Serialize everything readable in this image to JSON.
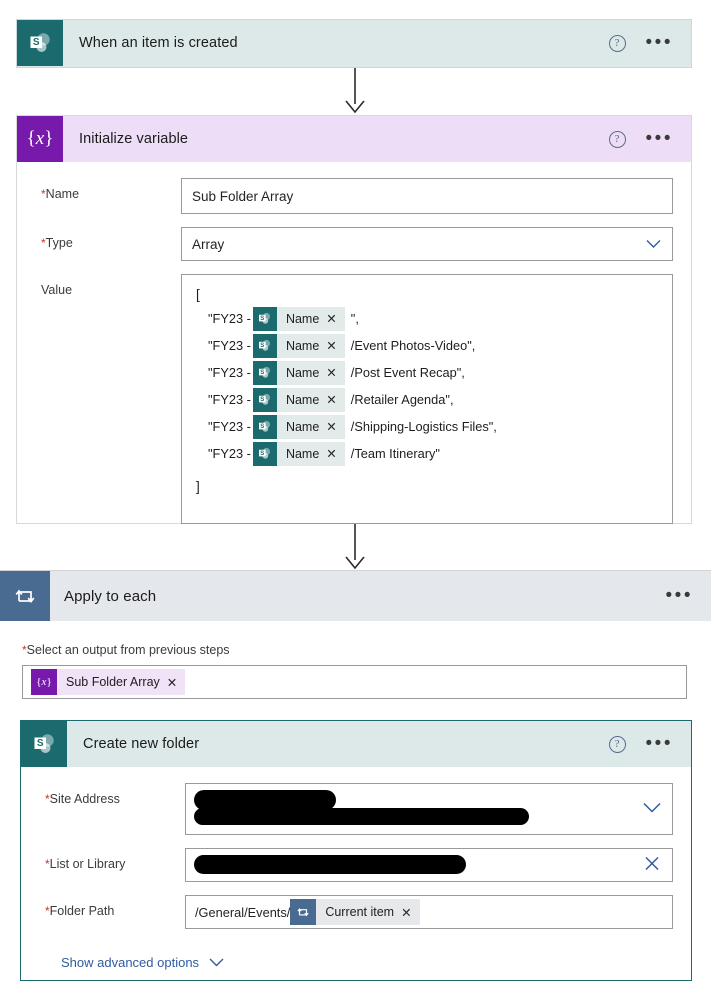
{
  "flow": {
    "trigger": {
      "title": "When an item is created",
      "icon": "sharepoint-icon",
      "help_label": "?",
      "menu_label": "•••"
    },
    "initialize_variable": {
      "title": "Initialize variable",
      "icon": "variable-braces-icon",
      "help_label": "?",
      "menu_label": "•••",
      "fields": {
        "name": {
          "label": "Name",
          "required": true,
          "value": "Sub Folder Array"
        },
        "type": {
          "label": "Type",
          "required": true,
          "value": "Array"
        },
        "value": {
          "label": "Value",
          "required": false,
          "open_bracket": "[",
          "close_bracket": "]",
          "rows": [
            {
              "prefix": "\"FY23 - ",
              "token": "Name",
              "suffix": "\","
            },
            {
              "prefix": "\"FY23 - ",
              "token": "Name",
              "suffix": "/Event Photos-Video\","
            },
            {
              "prefix": "\"FY23 - ",
              "token": "Name",
              "suffix": "/Post Event Recap\","
            },
            {
              "prefix": "\"FY23 - ",
              "token": "Name",
              "suffix": "/Retailer Agenda\","
            },
            {
              "prefix": "\"FY23 - ",
              "token": "Name",
              "suffix": "/Shipping-Logistics Files\","
            },
            {
              "prefix": "\"FY23 - ",
              "token": "Name",
              "suffix": "/Team Itinerary\""
            }
          ]
        }
      }
    },
    "apply_to_each": {
      "title": "Apply to each",
      "icon": "loop-icon",
      "menu_label": "•••",
      "output_field": {
        "label": "Select an output from previous steps",
        "required": true,
        "token": "Sub Folder Array"
      }
    },
    "create_new_folder": {
      "title": "Create new folder",
      "icon": "sharepoint-icon",
      "help_label": "?",
      "menu_label": "•••",
      "fields": {
        "site_address": {
          "label": "Site Address",
          "required": true,
          "value": "",
          "redacted": true
        },
        "list_or_library": {
          "label": "List or Library",
          "required": true,
          "value": "",
          "redacted": true
        },
        "folder_path": {
          "label": "Folder Path",
          "required": true,
          "value": "/General/Events/",
          "token": "Current item"
        }
      },
      "advanced_options_label": "Show advanced options"
    }
  },
  "colors": {
    "sharepoint_teal": "#1b6a6e",
    "trigger_header_bg": "#dde9e9",
    "variable_purple": "#7719aa",
    "variable_header_bg": "#eeddf7",
    "loop_blue": "#4a6b91",
    "loop_header_bg": "#e4e7ec",
    "link_blue": "#2f5c9e",
    "required_red": "#c0392b"
  }
}
